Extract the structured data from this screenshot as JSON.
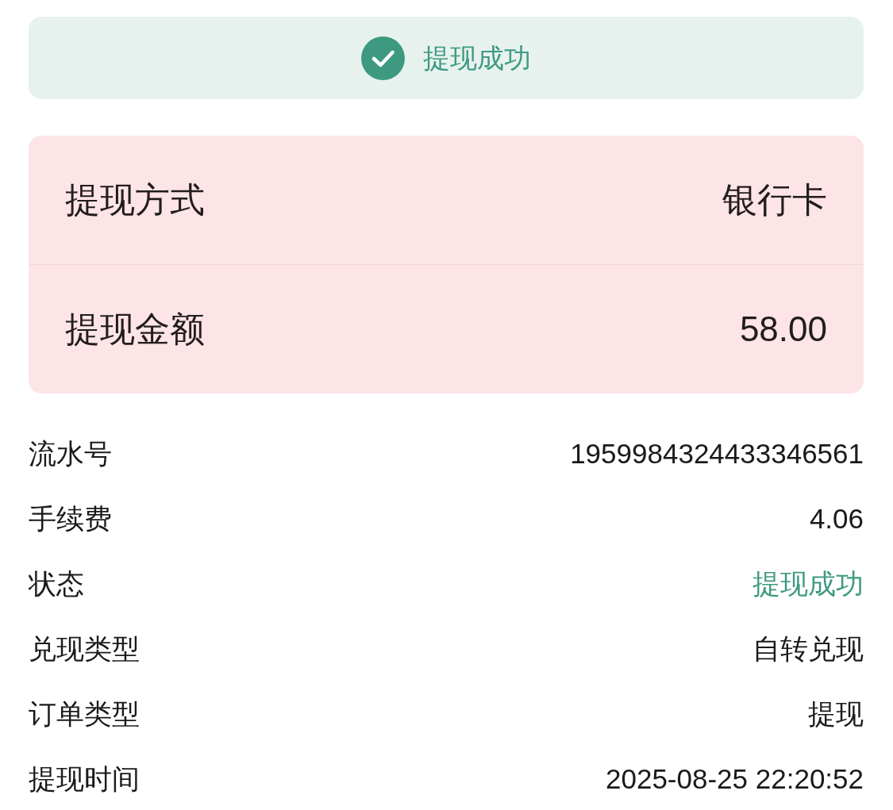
{
  "banner": {
    "kind": "success",
    "text": "提现成功"
  },
  "summary": [
    {
      "label": "提现方式",
      "value": "银行卡"
    },
    {
      "label": "提现金额",
      "value": "58.00"
    }
  ],
  "details": [
    {
      "label": "流水号",
      "value": "1959984324433346561",
      "kind": "plain"
    },
    {
      "label": "手续费",
      "value": "4.06",
      "kind": "plain"
    },
    {
      "label": "状态",
      "value": "提现成功",
      "kind": "status"
    },
    {
      "label": "兑现类型",
      "value": "自转兑现",
      "kind": "plain"
    },
    {
      "label": "订单类型",
      "value": "提现",
      "kind": "plain"
    },
    {
      "label": "提现时间",
      "value": "2025-08-25 22:20:52",
      "kind": "plain"
    }
  ]
}
